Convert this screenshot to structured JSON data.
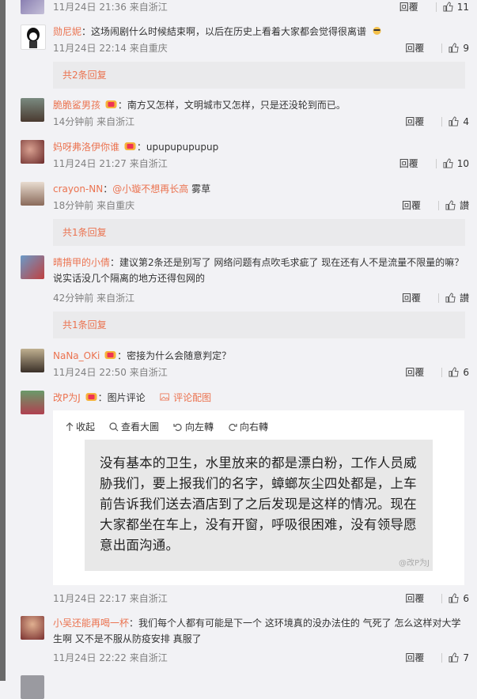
{
  "comments": [
    {
      "meta": "11月24日 21:36 来自浙江",
      "reply": "回覆",
      "likes": "11"
    },
    {
      "user": "勋尼妮",
      "text": "这场闹剧什么时候結束啊，以后在历史上看着大家都会觉得很离谱",
      "meta": "11月24日 22:14 来自重庆",
      "reply": "回覆",
      "likes": "9",
      "sub": "共2条回复"
    },
    {
      "user": "脆脆鲨男孩",
      "text": "南方又怎样，文明城市又怎样，只是还没轮到而已。",
      "meta": "14分钟前 来自浙江",
      "reply": "回覆",
      "likes": "4"
    },
    {
      "user": "妈呀弗洛伊你谁",
      "text": "upupupupupup",
      "meta": "11月24日 21:27 来自浙江",
      "reply": "回覆",
      "likes": "10"
    },
    {
      "user": "crayon-NN",
      "mention": "@小璇不想再长高",
      "text": "雾草",
      "meta": "18分钟前 来自重庆",
      "reply": "回覆",
      "likes": "讃",
      "sub": "共1条回复"
    },
    {
      "user": "晴揹甲的小倩",
      "text": "建议第2条还是别写了 网络问题有点吹毛求疵了 现在还有人不是流量不限量的嘛？说实话没几个隔离的地方还得包网的",
      "meta": "42分钟前 来自浙江",
      "reply": "回覆",
      "likes": "讃",
      "sub": "共1条回复"
    },
    {
      "user": "NaNa_OKi",
      "text": "密接为什么会随意判定？",
      "meta": "11月24日 22:50 来自浙江",
      "reply": "回覆",
      "likes": "6"
    },
    {
      "user": "改P为J",
      "text": "图片评论",
      "pic_label": "评论配图",
      "meta": "11月24日 22:17 来自浙江",
      "reply": "回覆",
      "likes": "6"
    },
    {
      "user": "小吴还能再喝一杯",
      "text": "我们每个人都有可能是下一个 这环境真的没办法住的 气死了 怎么这样对大学生啊 又不是不服从防疫安排 真服了",
      "meta": "11月24日 22:22 来自浙江",
      "reply": "回覆",
      "likes": "7"
    }
  ],
  "picture_toolbar": {
    "collapse": "收起",
    "view": "查看大圖",
    "rotate_left": "向左轉",
    "rotate_right": "向右轉"
  },
  "picture_text": "没有基本的卫生，水里放来的都是漂白粉，工作人员威胁我们，要上报我们的名字，蟑螂灰尘四处都是，上车前告诉我们送去酒店到了之后发现是这样的情况。现在大家都坐在车上，没有开窗，呼吸很困难，没有领导愿意出面沟通。",
  "picture_watermark": "@改P为J",
  "colors": {
    "accent": "#eb7350",
    "background": "#f2f2f5",
    "subreply": "#eaeaec"
  }
}
